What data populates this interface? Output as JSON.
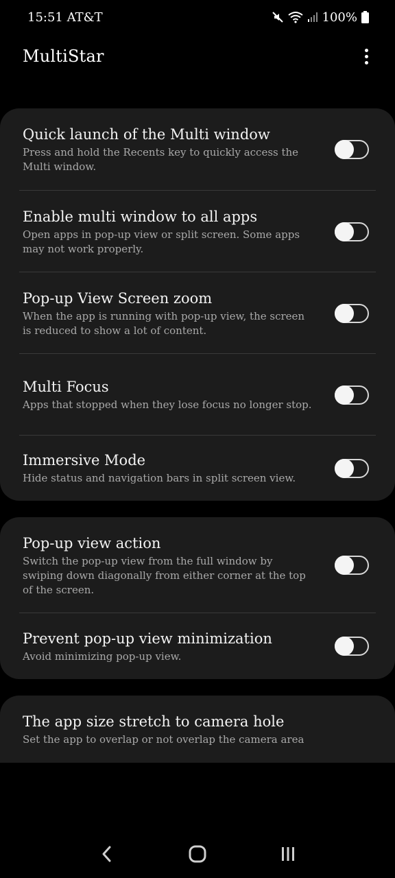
{
  "status_bar": {
    "time_carrier": "15:51 AT&T",
    "battery": "100%",
    "icons": [
      "mute-icon",
      "wifi-icon",
      "signal-icon",
      "battery-icon"
    ]
  },
  "app_bar": {
    "title": "MultiStar",
    "menu_icon": "more-vert-icon"
  },
  "sections": [
    {
      "items": [
        {
          "title": "Quick launch of the Multi window",
          "description": "Press and hold the Recents key to quickly access the Multi window.",
          "enabled": false
        },
        {
          "title": "Enable multi window to all apps",
          "description": "Open apps in pop-up view or split screen. Some apps may not work properly.",
          "enabled": false
        },
        {
          "title": "Pop-up View Screen zoom",
          "description": "When the app is running with pop-up view, the screen is reduced to show a lot of content.",
          "enabled": false
        },
        {
          "title": "Multi Focus",
          "description": "Apps that stopped when they lose focus no longer stop.",
          "enabled": false
        },
        {
          "title": "Immersive Mode",
          "description": "Hide status and navigation bars in split screen view.",
          "enabled": false
        }
      ]
    },
    {
      "items": [
        {
          "title": "Pop-up view action",
          "description": "Switch the pop-up view from the full window by swiping down diagonally from either corner at the top of the screen.",
          "enabled": false
        },
        {
          "title": "Prevent pop-up view minimization",
          "description": "Avoid minimizing pop-up view.",
          "enabled": false
        }
      ]
    },
    {
      "items": [
        {
          "title": "The app size stretch to camera hole",
          "description": "Set the app to overlap or not overlap the camera area"
        }
      ]
    }
  ],
  "nav_bar": {
    "buttons": [
      "back-icon",
      "home-icon",
      "recents-icon"
    ]
  },
  "colors": {
    "background": "#000000",
    "card": "#1c1c1c",
    "title_text": "#f2f2f2",
    "desc_text": "#a9a9a9",
    "divider": "#3a3a3a",
    "toggle": "#d8d8d8"
  }
}
